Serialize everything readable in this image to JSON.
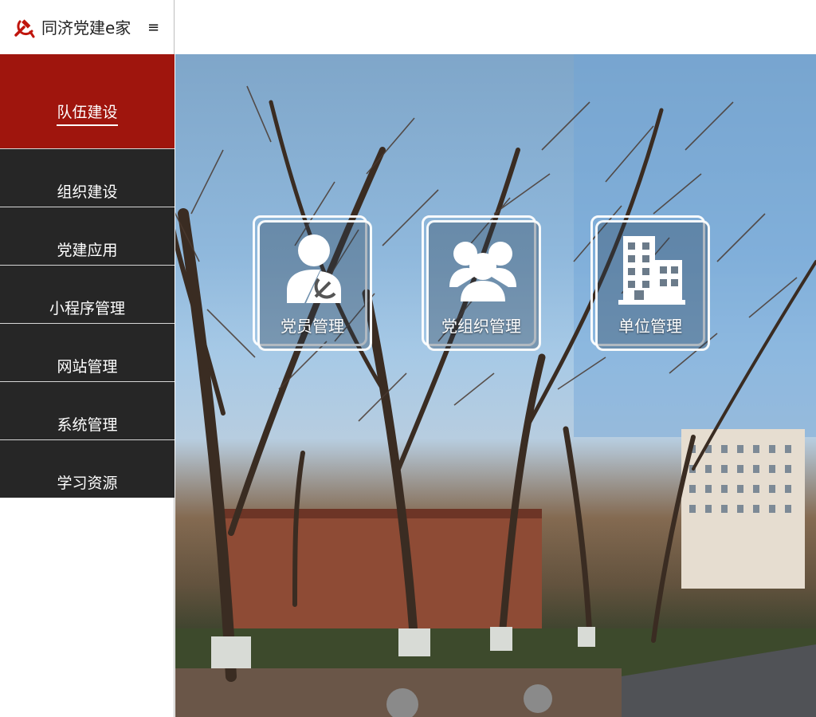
{
  "header": {
    "brand": "同济党建e家",
    "menu_toggle": "≡",
    "logo_icon": "hammer-sickle-icon"
  },
  "sidebar": {
    "items": [
      {
        "label": "队伍建设",
        "active": true
      },
      {
        "label": "组织建设",
        "active": false
      },
      {
        "label": "党建应用",
        "active": false
      },
      {
        "label": "小程序管理",
        "active": false
      },
      {
        "label": "网站管理",
        "active": false
      },
      {
        "label": "系统管理",
        "active": false
      },
      {
        "label": "学习资源",
        "active": false
      }
    ]
  },
  "main": {
    "tiles": [
      {
        "label": "党员管理",
        "icon": "member-icon"
      },
      {
        "label": "党组织管理",
        "icon": "group-icon"
      },
      {
        "label": "单位管理",
        "icon": "building-icon"
      }
    ]
  },
  "colors": {
    "active_nav": "#9f150d",
    "nav_bg": "#262626",
    "logo_red": "#c0150d"
  }
}
